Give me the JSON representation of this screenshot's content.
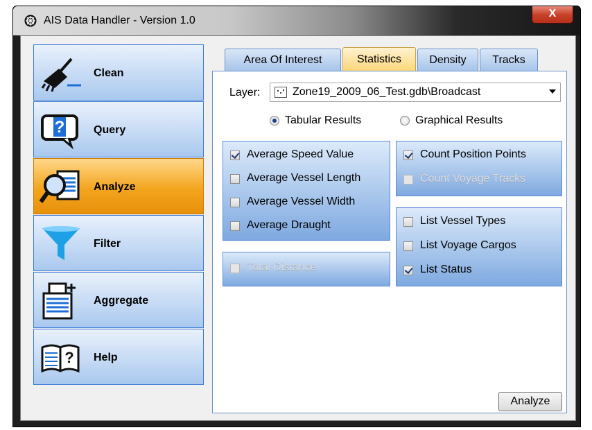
{
  "window": {
    "title": "AIS Data Handler - Version 1.0",
    "close_label": "X"
  },
  "sidebar": {
    "items": [
      {
        "label": "Clean",
        "icon": "broom-icon",
        "active": false
      },
      {
        "label": "Query",
        "icon": "speech-question-icon",
        "active": false
      },
      {
        "label": "Analyze",
        "icon": "magnifier-document-icon",
        "active": true
      },
      {
        "label": "Filter",
        "icon": "funnel-icon",
        "active": false
      },
      {
        "label": "Aggregate",
        "icon": "add-documents-icon",
        "active": false
      },
      {
        "label": "Help",
        "icon": "book-question-icon",
        "active": false
      }
    ]
  },
  "tabs": [
    {
      "label": "Area Of Interest",
      "active": false
    },
    {
      "label": "Statistics",
      "active": true
    },
    {
      "label": "Density",
      "active": false
    },
    {
      "label": "Tracks",
      "active": false
    }
  ],
  "statistics": {
    "layer_label": "Layer:",
    "layer_value": "Zone19_2009_06_Test.gdb\\Broadcast",
    "radio_tabular": "Tabular Results",
    "radio_graphical": "Graphical Results",
    "group_left_top": [
      {
        "label": "Average Speed Value",
        "checked": true,
        "enabled": true
      },
      {
        "label": "Average Vessel Length",
        "checked": false,
        "enabled": true
      },
      {
        "label": "Average Vessel Width",
        "checked": false,
        "enabled": true
      },
      {
        "label": "Average Draught",
        "checked": false,
        "enabled": true
      }
    ],
    "group_left_bottom": [
      {
        "label": "Total Distance",
        "checked": false,
        "enabled": false
      }
    ],
    "group_right_top": [
      {
        "label": "Count Position Points",
        "checked": true,
        "enabled": true
      },
      {
        "label": "Count Voyage Tracks",
        "checked": false,
        "enabled": false
      }
    ],
    "group_right_bottom": [
      {
        "label": "List Vessel Types",
        "checked": false,
        "enabled": true
      },
      {
        "label": "List Voyage Cargos",
        "checked": false,
        "enabled": true
      },
      {
        "label": "List Status",
        "checked": true,
        "enabled": true
      }
    ],
    "analyze_button": "Analyze"
  },
  "colors": {
    "accent_active": "#f3a51e",
    "nav_blue": "#a9c8ee",
    "group_blue": "#7ea9e0"
  }
}
